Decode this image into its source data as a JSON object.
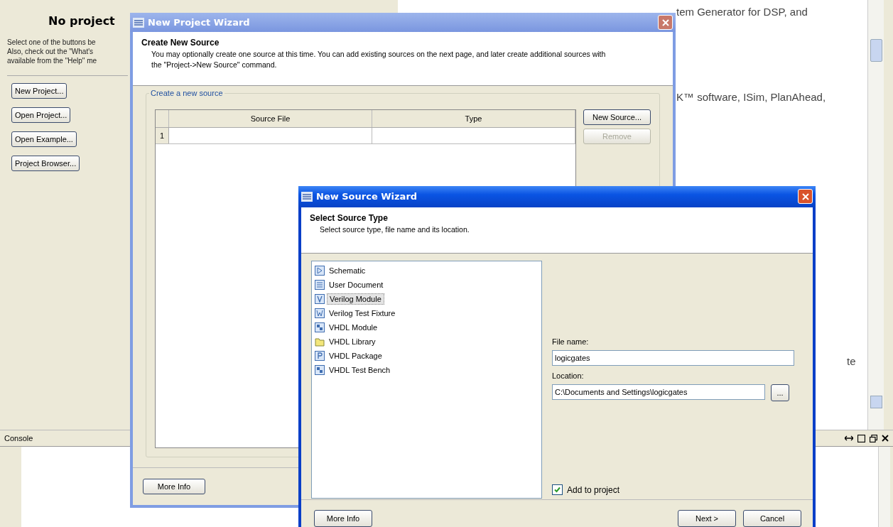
{
  "start_page": {
    "heading": "No project",
    "intro_lines": [
      "Select one of the buttons be",
      "Also, check out the \"What's",
      "available from the \"Help\" me"
    ],
    "buttons": [
      "New Project...",
      "Open Project...",
      "Open Example...",
      "Project Browser..."
    ],
    "right_texts": [
      "tem Generator for DSP, and",
      "K™ software, ISim, PlanAhead,",
      "te"
    ]
  },
  "console": {
    "title": "Console"
  },
  "project_wizard": {
    "title": "New Project Wizard",
    "header_title": "Create New Source",
    "header_text": "You may optionally create one source at this time. You can add existing sources on the next page, and later create additional sources with the \"Project->New Source\" command.",
    "group_label": "Create a new source",
    "columns": [
      "Source File",
      "Type"
    ],
    "row_numbers": [
      "1"
    ],
    "buttons": [
      {
        "label": "New Source...",
        "disabled": false
      },
      {
        "label": "Remove",
        "disabled": true
      }
    ],
    "more_info": "More Info"
  },
  "source_wizard": {
    "title": "New Source Wizard",
    "header_title": "Select Source Type",
    "header_text": "Select source type, file name and its location.",
    "source_types": [
      {
        "label": "Schematic",
        "kind": "schematic",
        "selected": false
      },
      {
        "label": "User Document",
        "kind": "document",
        "selected": false
      },
      {
        "label": "Verilog Module",
        "kind": "module",
        "selected": true
      },
      {
        "label": "Verilog Test Fixture",
        "kind": "fixture",
        "selected": false
      },
      {
        "label": "VHDL Module",
        "kind": "blocks",
        "selected": false
      },
      {
        "label": "VHDL Library",
        "kind": "library",
        "selected": false
      },
      {
        "label": "VHDL Package",
        "kind": "package",
        "selected": false
      },
      {
        "label": "VHDL Test Bench",
        "kind": "blocks",
        "selected": false
      }
    ],
    "file_name_label": "File name:",
    "file_name": "logicgates",
    "location_label": "Location:",
    "location": "C:\\Documents and Settings\\logicgates",
    "browse_label": "...",
    "add_to_project": {
      "label": "Add to project",
      "checked": true
    },
    "buttons": [
      "More Info",
      "Next >",
      "Cancel"
    ]
  }
}
